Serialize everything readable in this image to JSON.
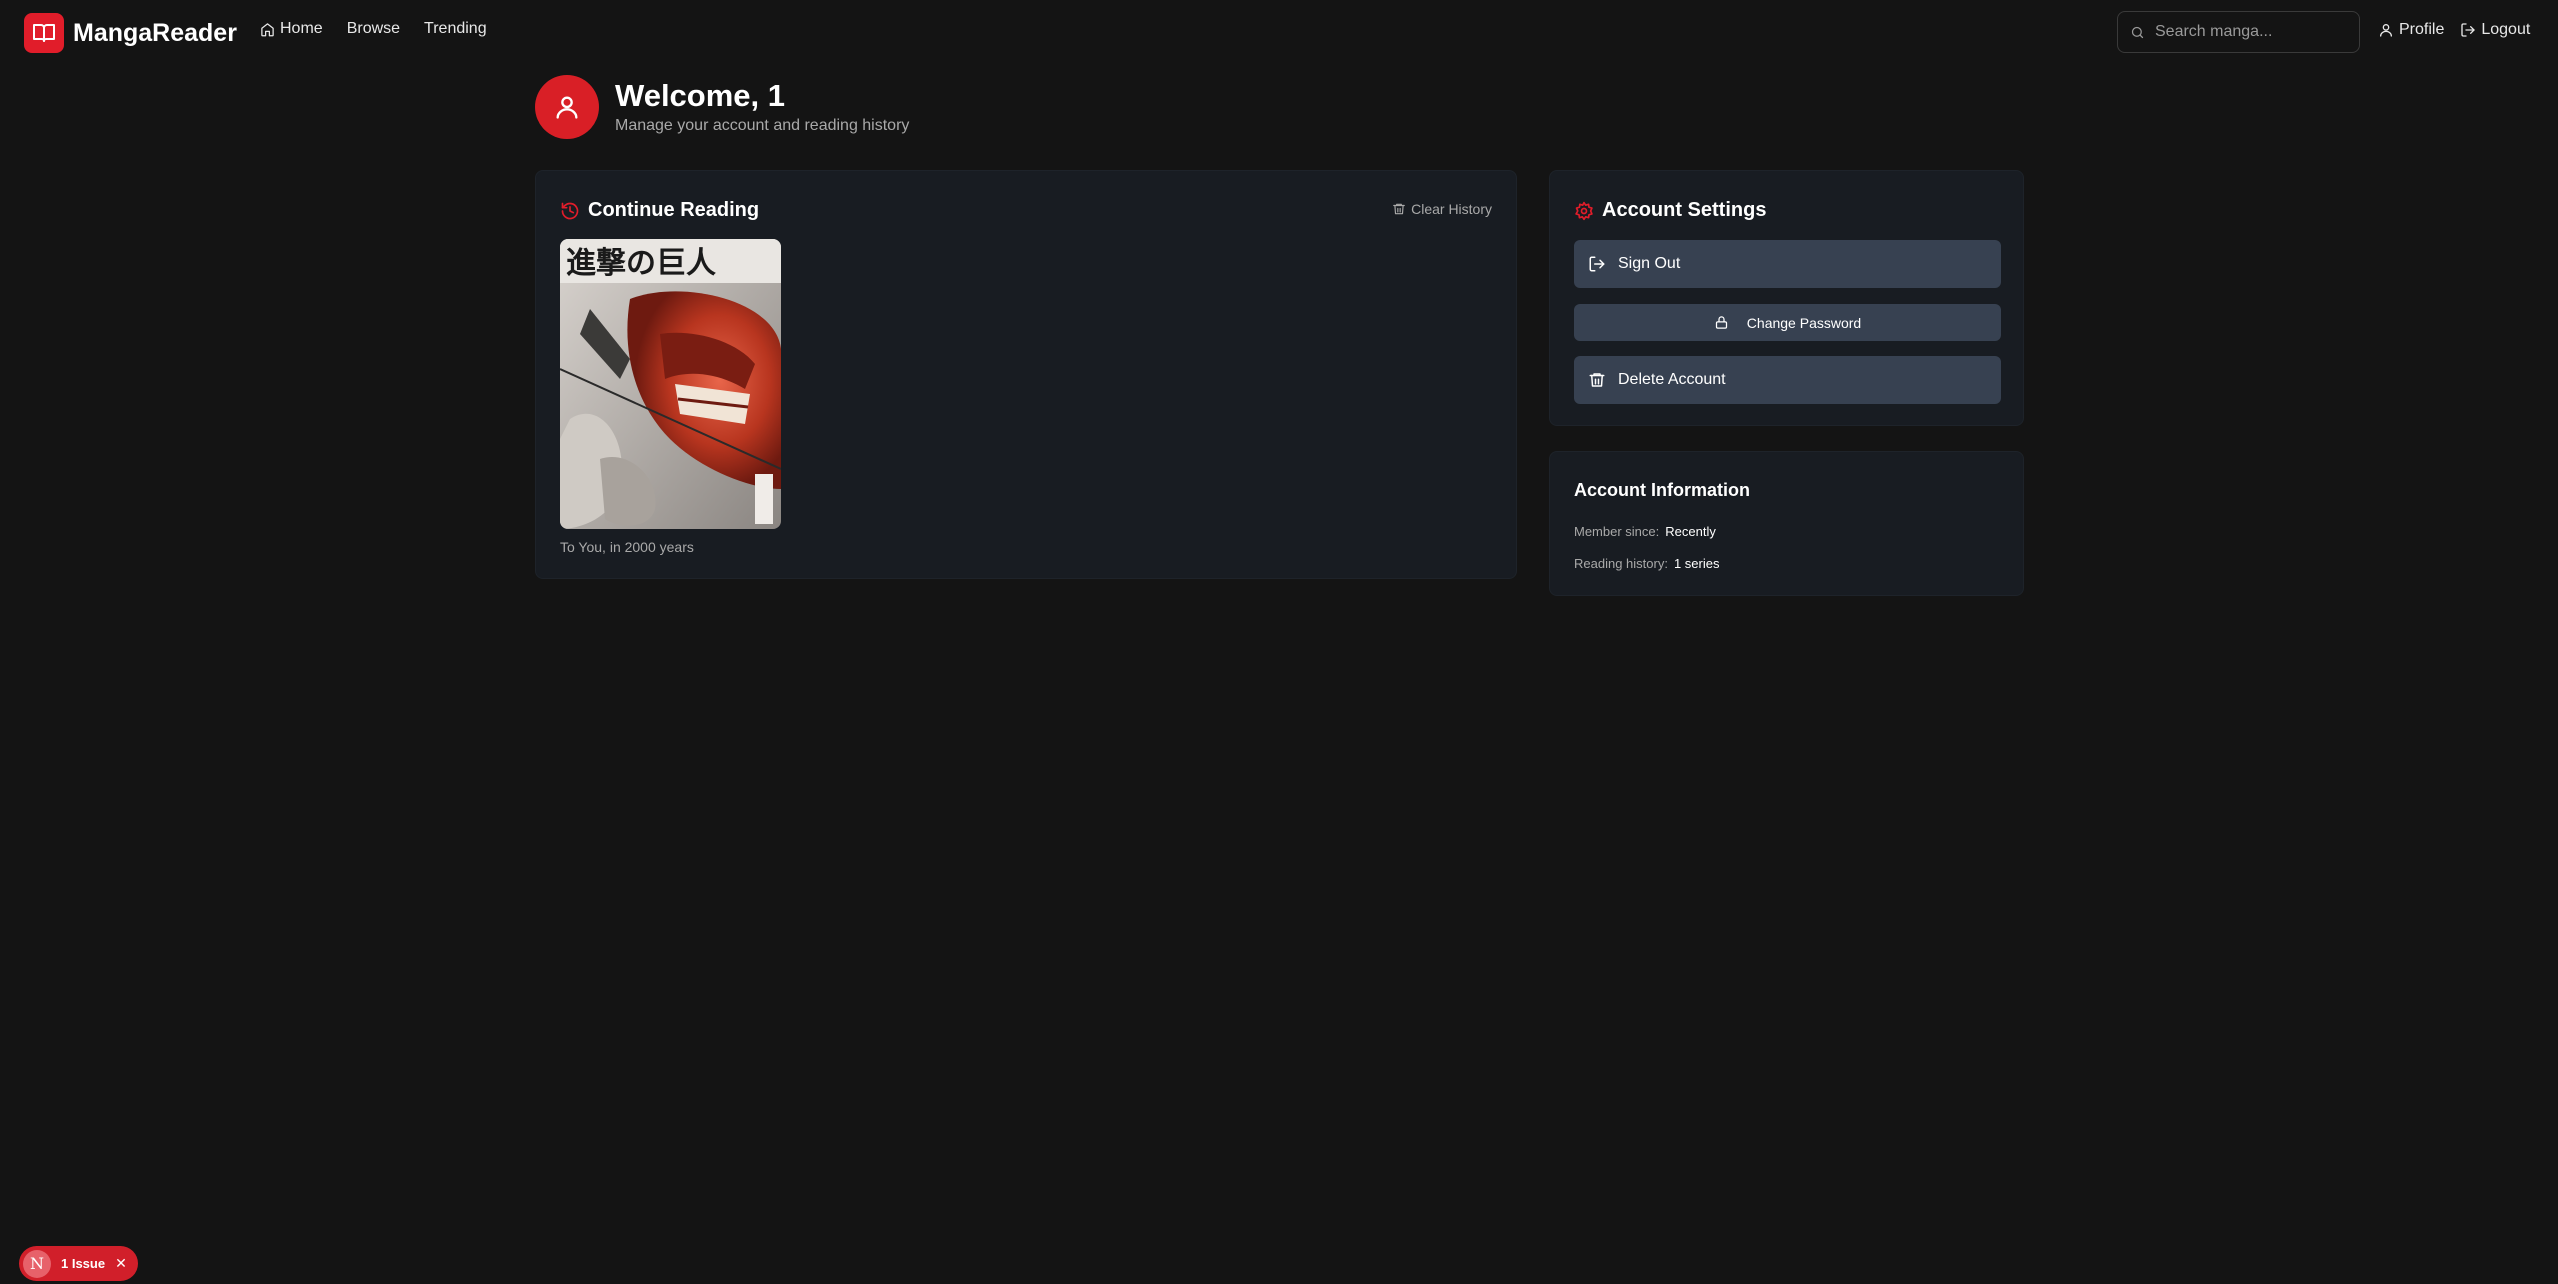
{
  "nav": {
    "brand": "MangaReader",
    "links": [
      "Home",
      "Browse",
      "Trending"
    ],
    "search_placeholder": "Search manga...",
    "profile": "Profile",
    "logout": "Logout"
  },
  "welcome": {
    "title": "Welcome, 1",
    "subtitle": "Manage your account and reading history"
  },
  "continue_reading": {
    "title": "Continue Reading",
    "clear_label": "Clear History",
    "items": [
      {
        "title": "To You, in 2000 years",
        "cover_text": "進撃の巨人"
      }
    ]
  },
  "settings": {
    "title": "Account Settings",
    "sign_out": "Sign Out",
    "change_password": "Change Password",
    "delete_account": "Delete Account"
  },
  "info": {
    "title": "Account Information",
    "member_since_label": "Member since:",
    "member_since_value": "Recently",
    "history_label": "Reading history:",
    "history_value": "1 series"
  },
  "issue_badge": {
    "letter": "N",
    "label": "1 Issue",
    "close": "✕"
  },
  "colors": {
    "accent": "#e11d2a",
    "background": "#141414",
    "card": "#181c22",
    "button": "#374151"
  }
}
